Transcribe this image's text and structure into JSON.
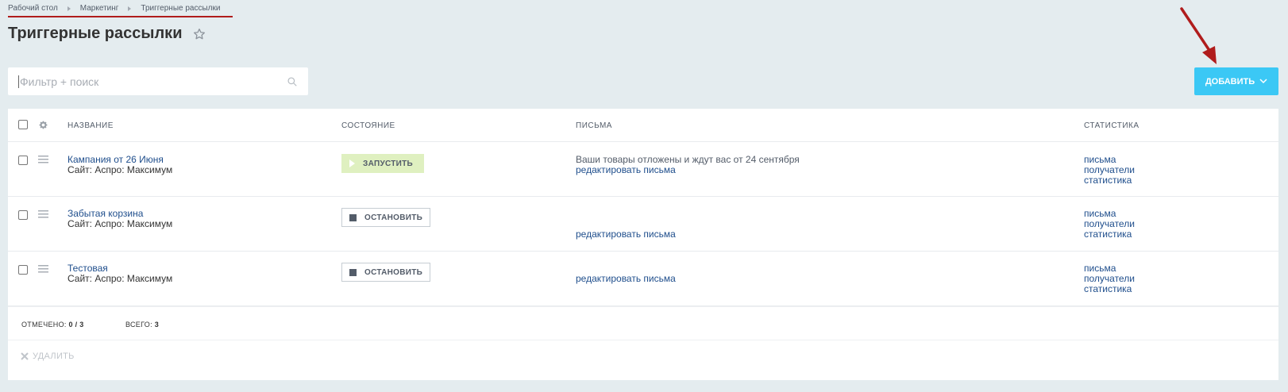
{
  "breadcrumbs": [
    "Рабочий стол",
    "Маркетинг",
    "Триггерные рассылки"
  ],
  "page_title": "Триггерные рассылки",
  "filter": {
    "placeholder": "Фильтр + поиск"
  },
  "add_button": "ДОБАВИТЬ",
  "table": {
    "headers": {
      "name": "НАЗВАНИЕ",
      "state": "СОСТОЯНИЕ",
      "letters": "ПИСЬМА",
      "stats": "СТАТИСТИКА"
    },
    "rows": [
      {
        "name": "Кампания от 26 Июня",
        "site": "Сайт: Аспро: Максимум",
        "action": "ЗАПУСТИТЬ",
        "letter_text": "Ваши товары отложены и ждут вас от 24 сентября",
        "edit_link": "редактировать письма",
        "stats": [
          "письма",
          "получатели",
          "статистика"
        ]
      },
      {
        "name": "Забытая корзина",
        "site": "Сайт: Аспро: Максимум",
        "action": "ОСТАНОВИТЬ",
        "letter_text": "",
        "edit_link": "редактировать письма",
        "stats": [
          "письма",
          "получатели",
          "статистика"
        ]
      },
      {
        "name": "Тестовая",
        "site": "Сайт: Аспро: Максимум",
        "action": "ОСТАНОВИТЬ",
        "letter_text": "",
        "edit_link": "редактировать письма",
        "stats": [
          "письма",
          "получатели",
          "статистика"
        ]
      }
    ]
  },
  "footer": {
    "selected_label": "ОТМЕЧЕНО:",
    "selected_value": "0 / 3",
    "total_label": "ВСЕГО:",
    "total_value": "3"
  },
  "delete_button": "УДАЛИТЬ",
  "colors": {
    "accent": "#3bc8f5",
    "start_button": "#dff0c0",
    "annotation": "#b01c1c"
  }
}
